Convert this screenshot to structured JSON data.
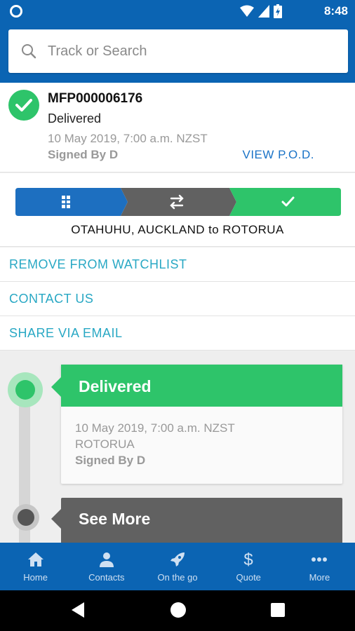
{
  "statusbar": {
    "time": "8:48"
  },
  "search": {
    "placeholder": "Track or Search"
  },
  "parcel": {
    "tracking_number": "MFP000006176",
    "status": "Delivered",
    "datetime": "10 May 2019, 7:00 a.m. NZST",
    "signed_by": "Signed By D",
    "view_pod_label": "VIEW P.O.D."
  },
  "progress": {
    "route": "OTAHUHU, AUCKLAND to ROTORUA",
    "stage_colors": [
      "#1d6fc0",
      "#616161",
      "#2ec46a"
    ]
  },
  "actions": {
    "remove_watchlist": "REMOVE FROM WATCHLIST",
    "contact_us": "CONTACT US",
    "share_email": "SHARE VIA EMAIL"
  },
  "timeline": {
    "events": [
      {
        "title": "Delivered",
        "datetime": "10 May 2019, 7:00 a.m. NZST",
        "location": "ROTORUA",
        "signed_by": "Signed By D"
      }
    ],
    "see_more_label": "See More"
  },
  "bottom_nav": {
    "items": [
      {
        "label": "Home",
        "icon": "home-icon"
      },
      {
        "label": "Contacts",
        "icon": "person-icon"
      },
      {
        "label": "On the go",
        "icon": "rocket-icon"
      },
      {
        "label": "Quote",
        "icon": "dollar-icon"
      },
      {
        "label": "More",
        "icon": "more-dots-icon"
      }
    ]
  },
  "colors": {
    "brand_blue": "#0b64b3",
    "success_green": "#2ec46a",
    "link_teal": "#29a8c4",
    "link_blue": "#1a73c7",
    "dark_grey": "#616161"
  }
}
